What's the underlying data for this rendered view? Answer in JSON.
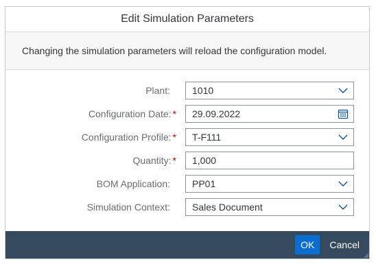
{
  "dialog": {
    "title": "Edit Simulation Parameters",
    "message": "Changing the simulation parameters will reload the configuration model."
  },
  "fields": [
    {
      "label": "Plant",
      "required": false,
      "value": "1010",
      "icon": "chevron-down-icon"
    },
    {
      "label": "Configuration Date",
      "required": true,
      "value": "29.09.2022",
      "icon": "calendar-icon"
    },
    {
      "label": "Configuration Profile",
      "required": true,
      "value": "T-F111",
      "icon": "chevron-down-icon"
    },
    {
      "label": "Quantity",
      "required": true,
      "value": "1,000",
      "icon": ""
    },
    {
      "label": "BOM Application",
      "required": false,
      "value": "PP01",
      "icon": "chevron-down-icon"
    },
    {
      "label": "Simulation Context",
      "required": false,
      "value": "Sales Document",
      "icon": "chevron-down-icon"
    }
  ],
  "buttons": {
    "ok_label": "OK",
    "cancel_label": "Cancel"
  },
  "colors": {
    "footer_bg": "#354a5f",
    "primary_button": "#0a6ed1",
    "required_star": "#bb0000",
    "icon": "#0854a0"
  },
  "labels": {
    "colon": ":",
    "required_mark": "*"
  }
}
